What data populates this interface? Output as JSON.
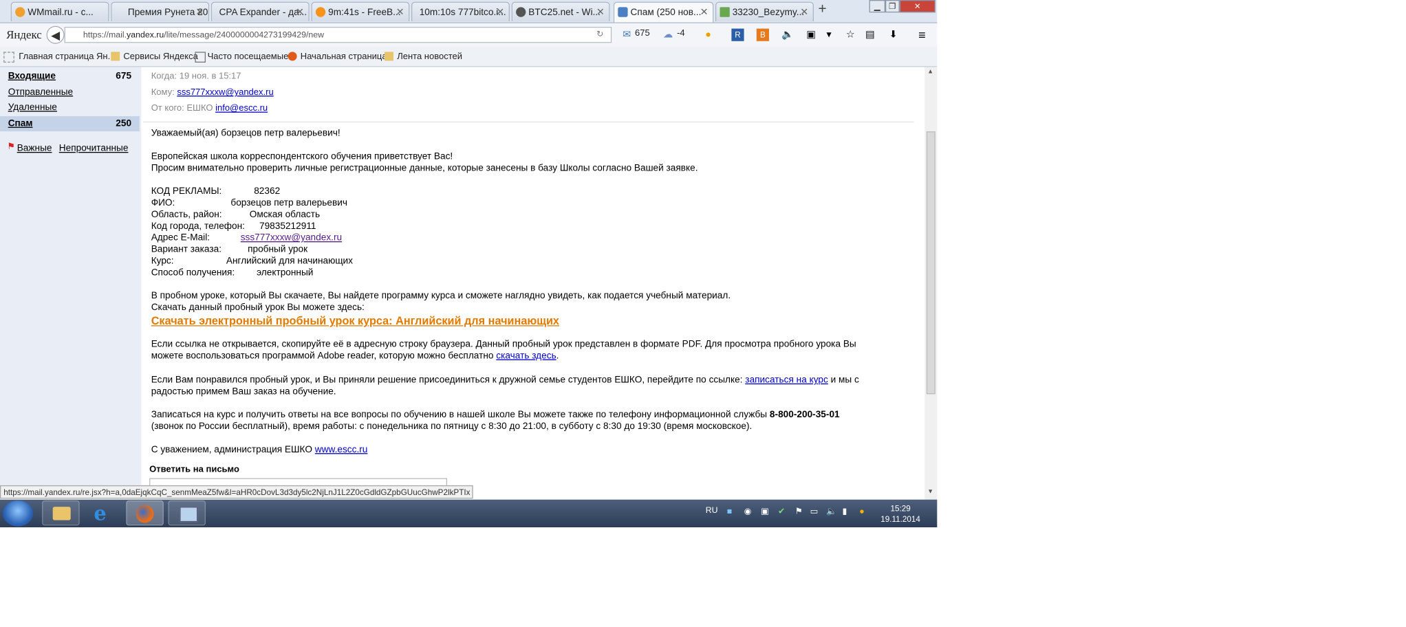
{
  "browser": {
    "tabs": [
      {
        "label": "WMmail.ru - с...",
        "icon_color": "#f0a030"
      },
      {
        "label": "Премия Рунета 20...",
        "icon_color": ""
      },
      {
        "label": "CPA Expander - да...",
        "icon_color": ""
      },
      {
        "label": "9m:41s - FreeB...",
        "icon_color": "#f7931a"
      },
      {
        "label": "10m:10s 777bitco.i...",
        "icon_color": ""
      },
      {
        "label": "BTC25.net - Wi...",
        "icon_color": "#555555"
      },
      {
        "label": "Спам (250 нов...",
        "icon_color": "#4a7fc4"
      },
      {
        "label": "33230_Bezymy...",
        "icon_color": "#6aa84f"
      }
    ],
    "logo": "Яндекс",
    "url_prefix": "https://mail.",
    "url_host": "yandex.ru",
    "url_path": "/lite/message/2400000004273199429/new",
    "mail_count": "675",
    "weather": "-4",
    "bookmarks": [
      "Главная страница Ян...",
      "Сервисы Яндекса",
      "Часто посещаемые",
      "Начальная страница",
      "Лента новостей"
    ],
    "status_url": "https://mail.yandex.ru/re.jsx?h=a,0daEjqkCqC_senmMeaZ5fw&l=aHR0cDovL3d3dy5lc2NjLnJ1L2Z0cGdldGZpbGUucGhwP2lkPTIx"
  },
  "sidebar": {
    "folders": [
      {
        "label": "Входящие",
        "count": "675",
        "bold": true,
        "selected": false
      },
      {
        "label": "Отправленные",
        "count": "",
        "bold": false,
        "selected": false
      },
      {
        "label": "Удаленные",
        "count": "",
        "bold": false,
        "selected": false
      },
      {
        "label": "Спам",
        "count": "250",
        "bold": true,
        "selected": true
      }
    ],
    "important": "Важные",
    "unread": "Непрочитанные"
  },
  "message": {
    "when_label": "Когда:",
    "when_value": "19 ноя. в 15:17",
    "to_label": "Кому:",
    "to_value": "sss777xxxw@yandex.ru",
    "from_label": "От кого:",
    "from_name": "ЕШКО",
    "from_email": "info@escc.ru",
    "greeting": "Уважаемый(ая) борзецов петр валерьевич!",
    "intro1": "Европейская школа корреспондентского обучения приветствует Вас!",
    "intro2": "Просим внимательно проверить личные регистрационные данные, которые занесены в базу Школы согласно Вашей заявке.",
    "fields": [
      {
        "label": "КОД РЕКЛАМЫ:",
        "value": "82362",
        "link": false
      },
      {
        "label": "ФИО:",
        "value": "борзецов петр валерьевич",
        "link": false
      },
      {
        "label": "Область, район:",
        "value": "Омская область",
        "link": false
      },
      {
        "label": "Код города, телефон:",
        "value": "79835212911",
        "link": false
      },
      {
        "label": "Адрес E-Mail:",
        "value": "sss777xxxw@yandex.ru",
        "link": true
      },
      {
        "label": "Вариант заказа:",
        "value": "пробный урок",
        "link": false
      },
      {
        "label": "Курс:",
        "value": "Английский для начинающих",
        "link": false
      },
      {
        "label": "Способ получения:",
        "value": "электронный",
        "link": false
      }
    ],
    "trial1": "В пробном уроке, который Вы скачаете, Вы найдете программу курса и сможете наглядно увидеть, как подается учебный материал.",
    "trial2": "Скачать данный пробный урок Вы можете здесь:",
    "download_link": "Скачать электронный пробный урок курса: Английский для начинающих",
    "copy1": "Если ссылка не открывается, скопируйте её в адресную строку браузера. Данный пробный урок представлен в формате PDF. Для просмотра пробного урока Вы",
    "copy2_pre": "можете воспользоваться программой Adobe reader, которую можно бесплатно",
    "copy2_link": "скачать здесь",
    "copy2_post": ".",
    "join1_pre": "Если Вам понравился пробный урок, и Вы приняли решение присоединиться к дружной семье студентов ЕШКО, перейдите по ссылке:",
    "join1_link": "записаться на курс",
    "join1_post": "и мы с",
    "join2": "радостью примем Ваш заказ на обучение.",
    "phone1_pre": "Записаться на курс и получить ответы на все вопросы по обучению в нашей школе Вы можете также по телефону информационной службы",
    "phone_number": "8-800-200-35-01",
    "phone2": "(звонок по России бесплатный), время работы: с понедельника по пятницу с 8:30 до 21:00, в субботу с 8:30 до 19:30 (время московское).",
    "regards_pre": "С уважением, администрация ЕШКО",
    "regards_link": "www.escc.ru",
    "reply_label": "Ответить на письмо"
  },
  "taskbar": {
    "lang": "RU",
    "time": "15:29",
    "date": "19.11.2014"
  }
}
